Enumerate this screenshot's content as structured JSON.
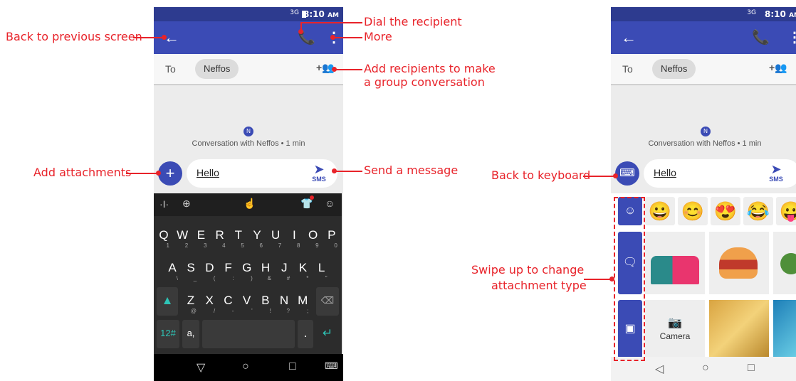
{
  "annotations": {
    "back": "Back to previous screen",
    "dial": "Dial the recipient",
    "more": "More",
    "add_recipients_line1": "Add recipients to make",
    "add_recipients_line2": "a group conversation",
    "attachments": "Add attachments",
    "send": "Send a message",
    "back_keyboard": "Back to keyboard",
    "swipe_line1": "Swipe up to change",
    "swipe_line2": "attachment type"
  },
  "status_bar": {
    "network": "3G",
    "time": "8:10",
    "ampm": "AM"
  },
  "compose": {
    "to_label": "To",
    "recipient": "Neffos",
    "avatar_letter": "N",
    "conversation_info": "Conversation with Neffos • 1 min",
    "message_text": "Hello",
    "send_sub_label": "SMS"
  },
  "keyboard": {
    "row1": [
      {
        "k": "Q",
        "s": "1"
      },
      {
        "k": "W",
        "s": "2"
      },
      {
        "k": "E",
        "s": "3"
      },
      {
        "k": "R",
        "s": "4"
      },
      {
        "k": "T",
        "s": "5"
      },
      {
        "k": "Y",
        "s": "6"
      },
      {
        "k": "U",
        "s": "7"
      },
      {
        "k": "I",
        "s": "8"
      },
      {
        "k": "O",
        "s": "9"
      },
      {
        "k": "P",
        "s": "0"
      }
    ],
    "row2": [
      {
        "k": "A",
        "s": "\\"
      },
      {
        "k": "S",
        "s": "_"
      },
      {
        "k": "D",
        "s": "("
      },
      {
        "k": "F",
        "s": ":"
      },
      {
        "k": "G",
        "s": ")"
      },
      {
        "k": "H",
        "s": "&"
      },
      {
        "k": "J",
        "s": "#"
      },
      {
        "k": "K",
        "s": "*"
      },
      {
        "k": "L",
        "s": "\""
      }
    ],
    "row3": [
      {
        "k": "Z",
        "s": "@"
      },
      {
        "k": "X",
        "s": "/"
      },
      {
        "k": "C",
        "s": "-"
      },
      {
        "k": "V",
        "s": "'"
      },
      {
        "k": "B",
        "s": "!"
      },
      {
        "k": "N",
        "s": "?"
      },
      {
        "k": "M",
        "s": ";"
      }
    ],
    "symbols_key": "12#",
    "comma_key": "a,",
    "period_key": "."
  },
  "attachment_panel": {
    "camera_label": "Camera",
    "emoji_row": [
      "😀",
      "😊",
      "😍",
      "😂",
      "😛"
    ]
  },
  "colors": {
    "accent": "#3b4bb5",
    "status_bar": "#2d3b8f",
    "annotation": "#e8232a"
  }
}
